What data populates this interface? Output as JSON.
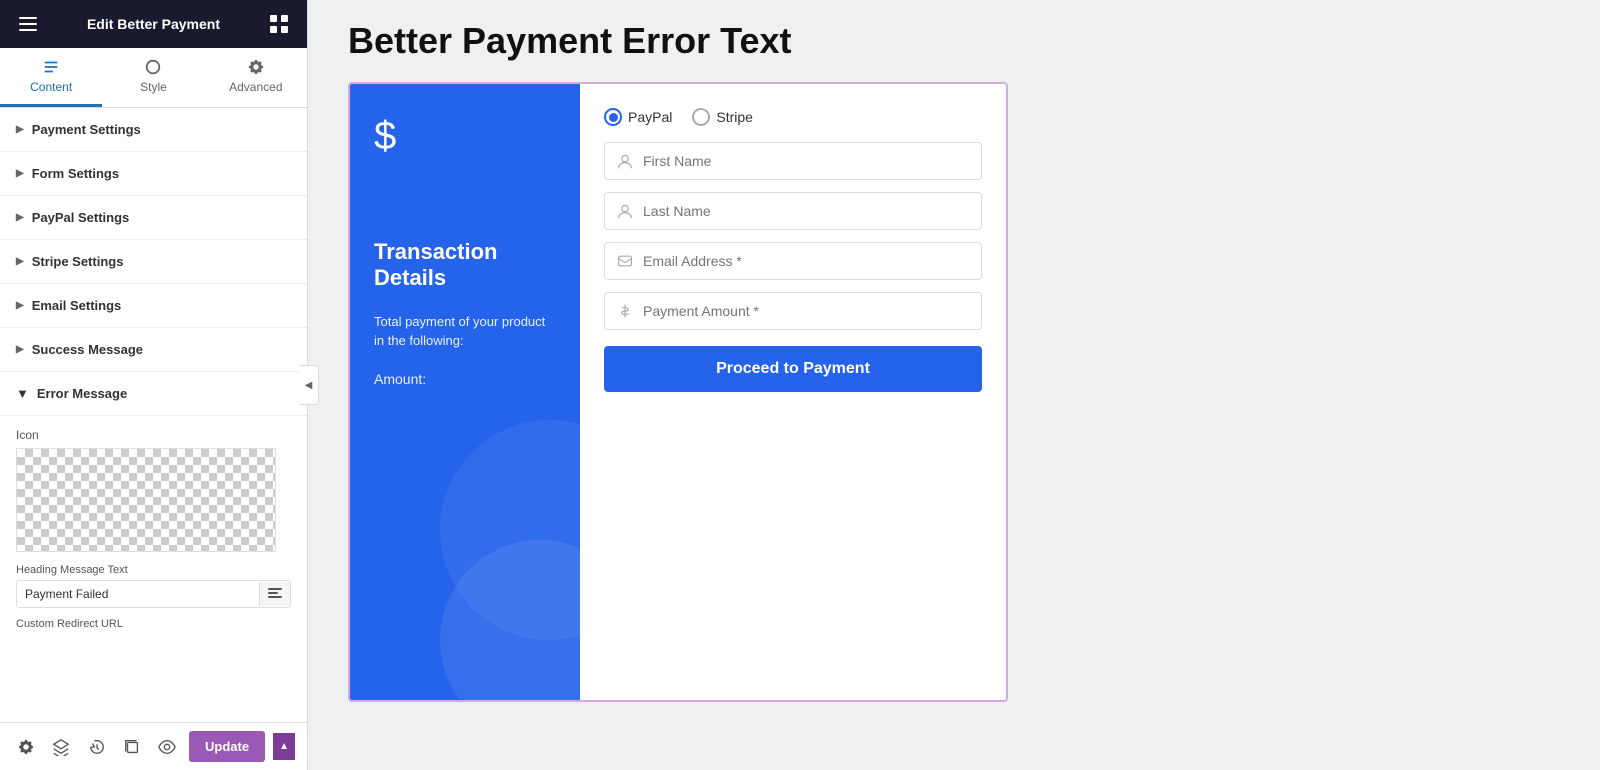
{
  "topBar": {
    "title": "Edit Better Payment"
  },
  "tabs": [
    {
      "id": "content",
      "label": "Content",
      "active": true
    },
    {
      "id": "style",
      "label": "Style",
      "active": false
    },
    {
      "id": "advanced",
      "label": "Advanced",
      "active": false
    }
  ],
  "sidebar": {
    "sections": [
      {
        "id": "payment-settings",
        "label": "Payment Settings",
        "expanded": false
      },
      {
        "id": "form-settings",
        "label": "Form Settings",
        "expanded": false
      },
      {
        "id": "paypal-settings",
        "label": "PayPal Settings",
        "expanded": false
      },
      {
        "id": "stripe-settings",
        "label": "Stripe Settings",
        "expanded": false
      },
      {
        "id": "email-settings",
        "label": "Email Settings",
        "expanded": false
      },
      {
        "id": "success-message",
        "label": "Success Message",
        "expanded": false
      }
    ],
    "errorMessage": {
      "label": "Error Message",
      "expanded": true,
      "iconLabel": "Icon",
      "headingLabel": "Heading Message Text",
      "headingValue": "Payment Failed",
      "redirectLabel": "Custom Redirect URL"
    }
  },
  "bottomBar": {
    "updateLabel": "Update"
  },
  "main": {
    "pageTitle": "Better Payment Error Text",
    "widget": {
      "left": {
        "dollarSymbol": "$",
        "transactionTitle": "Transaction Details",
        "description": "Total payment of your product in the following:",
        "amountLabel": "Amount:"
      },
      "right": {
        "paypalLabel": "PayPal",
        "stripeLabel": "Stripe",
        "fields": [
          {
            "id": "first-name",
            "placeholder": "First Name",
            "icon": "user"
          },
          {
            "id": "last-name",
            "placeholder": "Last Name",
            "icon": "user"
          },
          {
            "id": "email-address",
            "placeholder": "Email Address *",
            "icon": "email"
          },
          {
            "id": "payment-amount",
            "placeholder": "Payment Amount *",
            "icon": "dollar"
          }
        ],
        "proceedLabel": "Proceed to Payment"
      }
    }
  }
}
